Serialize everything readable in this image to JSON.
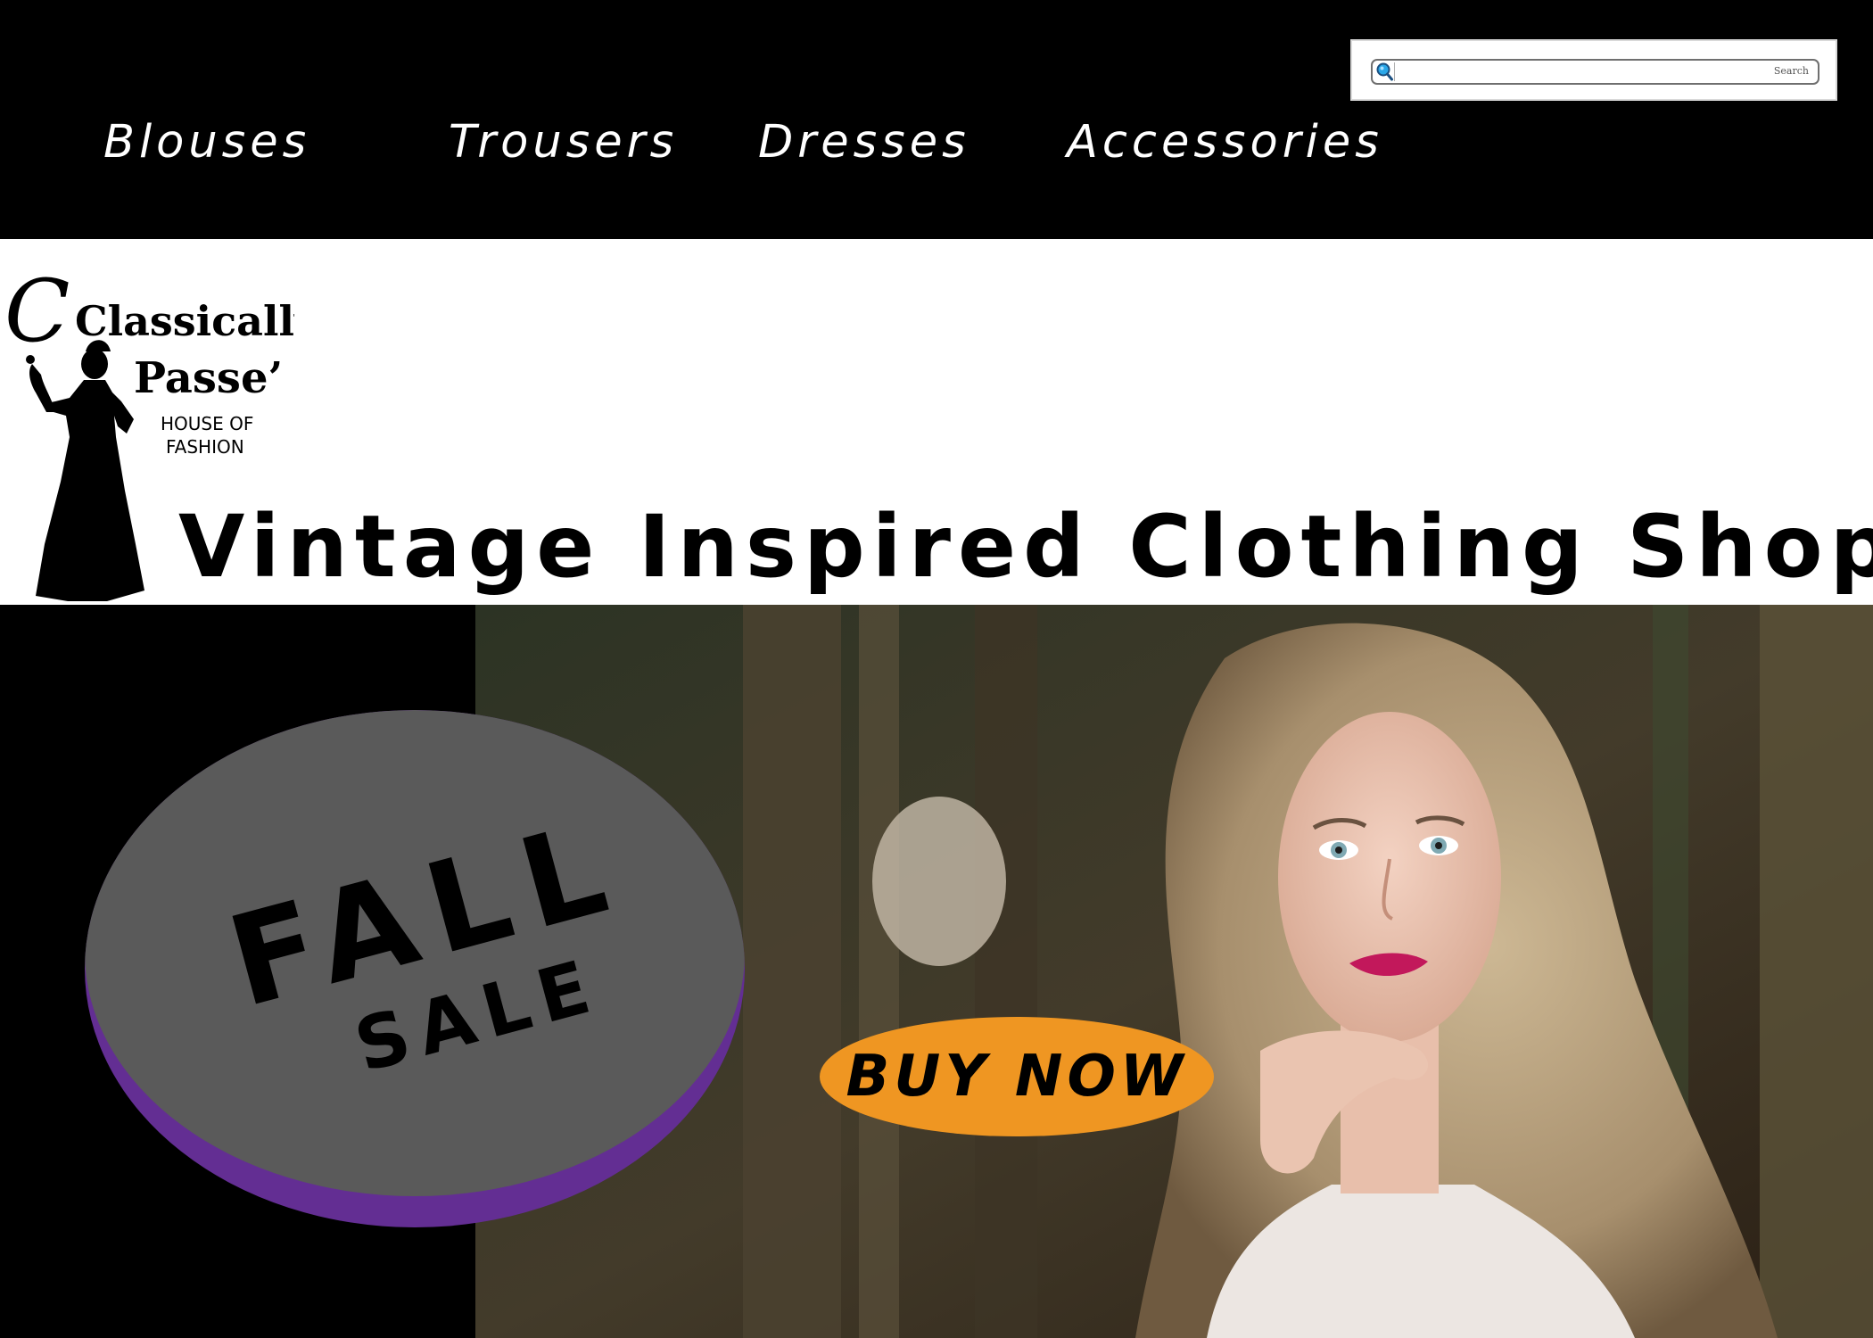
{
  "header": {
    "nav": [
      {
        "label": "Blouses"
      },
      {
        "label": "Trousers"
      },
      {
        "label": "Dresses"
      },
      {
        "label": "Accessories"
      }
    ],
    "search": {
      "button_label": "Search",
      "value": "",
      "icon": "search-icon"
    }
  },
  "brand": {
    "logo_text": [
      "Classically",
      "Passe’",
      "HOUSE OF",
      "FASHION"
    ],
    "tagline": "Vintage Inspired Clothing Shop"
  },
  "hero": {
    "badge_title": "FALL",
    "badge_subtitle": "SALE",
    "cta_label": "BUY NOW"
  },
  "colors": {
    "nav_background": "#000000",
    "badge_gray": "#5a5a5a",
    "badge_purple": "#632e93",
    "cta_orange": "#ef9622"
  }
}
